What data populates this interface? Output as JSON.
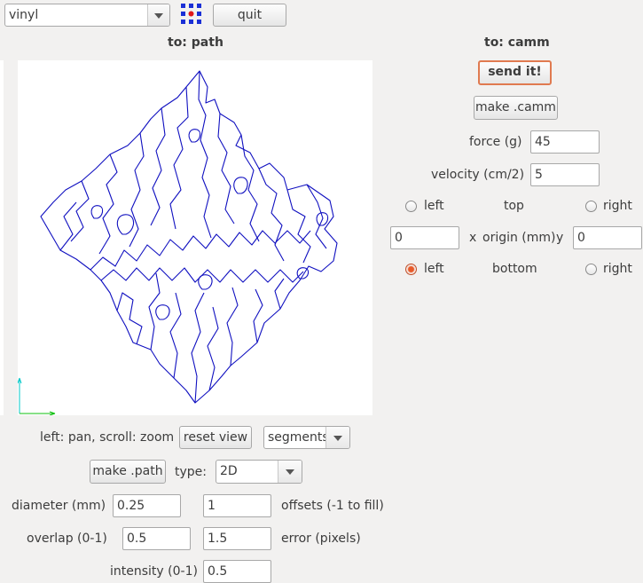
{
  "toolbar": {
    "mode_value": "vinyl",
    "quit_label": "quit",
    "app_icon": "grid-dots-icon",
    "colors": {
      "icon_blue": "#1a2fd6",
      "icon_red": "#e01818",
      "accent": "#e07a50"
    }
  },
  "left_panel": {
    "title": "to: path",
    "nav_hint": "left: pan, scroll: zoom",
    "reset_view_label": "reset view",
    "display_mode_value": "segments",
    "make_path_label": "make .path",
    "type_label": "type:",
    "type_value": "2D",
    "diameter_label": "diameter (mm)",
    "diameter_value": "0.25",
    "offsets_value": "1",
    "offsets_label": "offsets (-1 to fill)",
    "overlap_label": "overlap (0-1)",
    "overlap_value": "0.5",
    "error_value": "1.5",
    "error_label": "error (pixels)",
    "intensity_label": "intensity (0-1)",
    "intensity_value": "0.5",
    "path_color": "#1010c0"
  },
  "right_panel": {
    "title": "to: camm",
    "send_label": "send it!",
    "make_camm_label": "make .camm",
    "force_label": "force (g)",
    "force_value": "45",
    "velocity_label": "velocity (cm/2)",
    "velocity_value": "5",
    "top_row": {
      "left": "left",
      "center": "top",
      "right": "right"
    },
    "origin": {
      "x_value": "0",
      "x_label": "x",
      "origin_label": "origin (mm)",
      "y_label": "y",
      "y_value": "0"
    },
    "bottom_row": {
      "left": "left",
      "center": "bottom",
      "right": "right"
    }
  }
}
